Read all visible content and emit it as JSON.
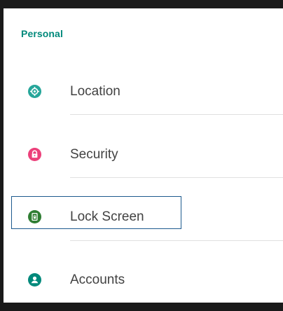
{
  "section": {
    "title": "Personal"
  },
  "items": [
    {
      "label": "Location",
      "icon": "location-icon",
      "color": "#26a69a"
    },
    {
      "label": "Security",
      "icon": "lock-icon",
      "color": "#ec407a"
    },
    {
      "label": "Lock Screen",
      "icon": "lock-screen-icon",
      "color": "#2e7d32"
    },
    {
      "label": "Accounts",
      "icon": "account-icon",
      "color": "#00897b"
    }
  ],
  "focused_item": "Lock Screen"
}
